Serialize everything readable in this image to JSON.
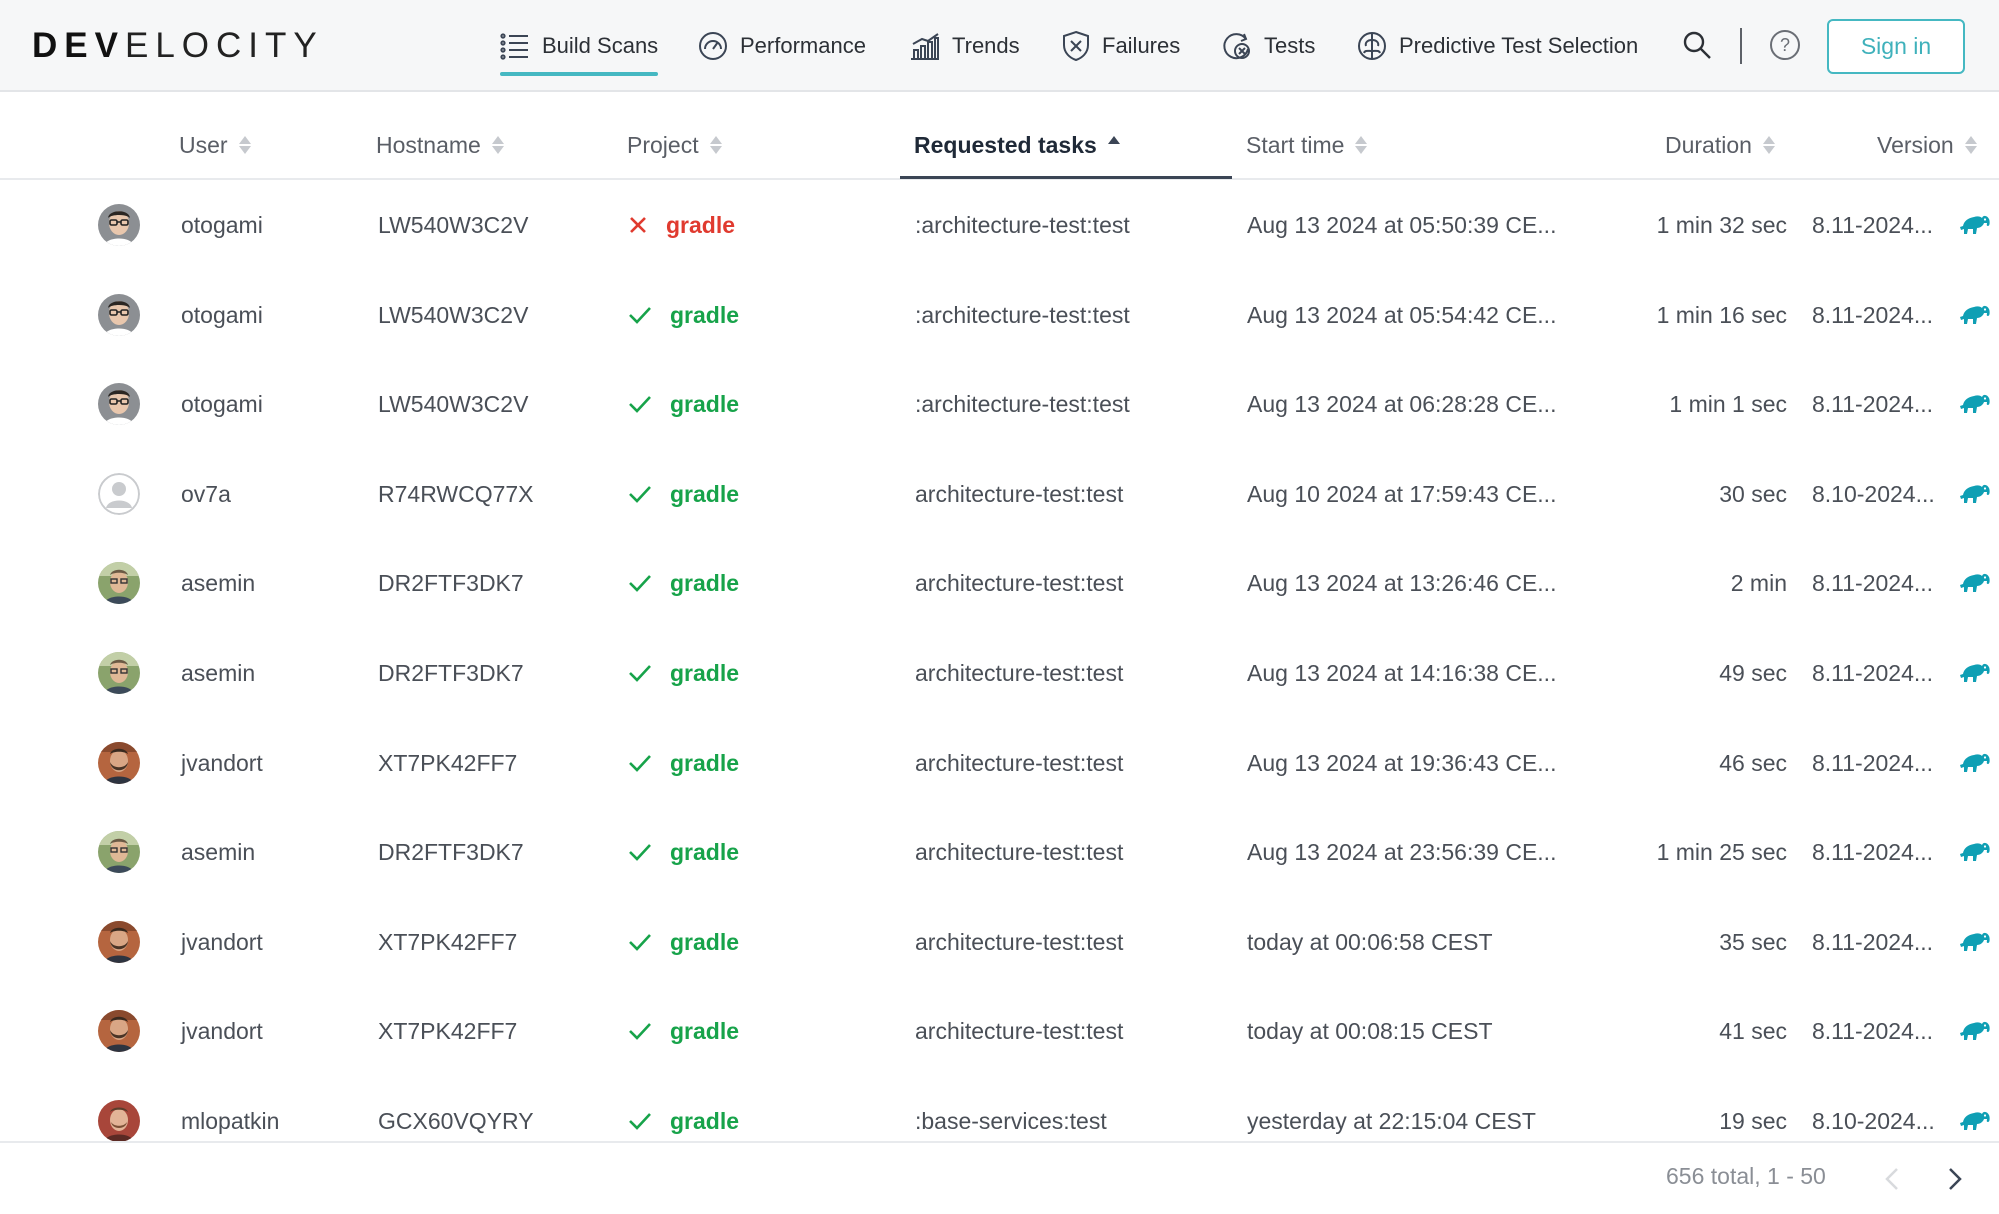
{
  "app": {
    "logo_bold": "DEV",
    "logo_light": "ELOCITY"
  },
  "nav": [
    {
      "label": "Build Scans",
      "icon": "list-icon",
      "active": true
    },
    {
      "label": "Performance",
      "icon": "gauge-icon",
      "active": false
    },
    {
      "label": "Trends",
      "icon": "chart-icon",
      "active": false
    },
    {
      "label": "Failures",
      "icon": "shield-x-icon",
      "active": false
    },
    {
      "label": "Tests",
      "icon": "test-icon",
      "active": false
    },
    {
      "label": "Predictive Test Selection",
      "icon": "brain-icon",
      "active": false
    }
  ],
  "header": {
    "signin_label": "Sign in"
  },
  "table": {
    "columns": [
      {
        "label": "User"
      },
      {
        "label": "Hostname"
      },
      {
        "label": "Project"
      },
      {
        "label": "Requested tasks",
        "active": true,
        "sort": "asc"
      },
      {
        "label": "Start time"
      },
      {
        "label": "Duration"
      },
      {
        "label": "Version"
      }
    ],
    "rows": [
      {
        "user": "otogami",
        "avatar": "glasses",
        "hostname": "LW540W3C2V",
        "status": "failed",
        "project": "gradle",
        "tasks": ":architecture-test:test",
        "start": "Aug 13 2024 at 05:50:39 CE...",
        "duration": "1 min 32 sec",
        "version": "8.11-2024..."
      },
      {
        "user": "otogami",
        "avatar": "glasses",
        "hostname": "LW540W3C2V",
        "status": "success",
        "project": "gradle",
        "tasks": ":architecture-test:test",
        "start": "Aug 13 2024 at 05:54:42 CE...",
        "duration": "1 min 16 sec",
        "version": "8.11-2024..."
      },
      {
        "user": "otogami",
        "avatar": "glasses",
        "hostname": "LW540W3C2V",
        "status": "success",
        "project": "gradle",
        "tasks": ":architecture-test:test",
        "start": "Aug 13 2024 at 06:28:28 CE...",
        "duration": "1 min 1 sec",
        "version": "8.11-2024..."
      },
      {
        "user": "ov7a",
        "avatar": "default",
        "hostname": "R74RWCQ77X",
        "status": "success",
        "project": "gradle",
        "tasks": "architecture-test:test",
        "start": "Aug 10 2024 at 17:59:43 CE...",
        "duration": "30 sec",
        "version": "8.10-2024..."
      },
      {
        "user": "asemin",
        "avatar": "outdoor",
        "hostname": "DR2FTF3DK7",
        "status": "success",
        "project": "gradle",
        "tasks": "architecture-test:test",
        "start": "Aug 13 2024 at 13:26:46 CE...",
        "duration": "2 min",
        "version": "8.11-2024..."
      },
      {
        "user": "asemin",
        "avatar": "outdoor",
        "hostname": "DR2FTF3DK7",
        "status": "success",
        "project": "gradle",
        "tasks": "architecture-test:test",
        "start": "Aug 13 2024 at 14:16:38 CE...",
        "duration": "49 sec",
        "version": "8.11-2024..."
      },
      {
        "user": "jvandort",
        "avatar": "beard",
        "hostname": "XT7PK42FF7",
        "status": "success",
        "project": "gradle",
        "tasks": "architecture-test:test",
        "start": "Aug 13 2024 at 19:36:43 CE...",
        "duration": "46 sec",
        "version": "8.11-2024..."
      },
      {
        "user": "asemin",
        "avatar": "outdoor",
        "hostname": "DR2FTF3DK7",
        "status": "success",
        "project": "gradle",
        "tasks": "architecture-test:test",
        "start": "Aug 13 2024 at 23:56:39 CE...",
        "duration": "1 min 25 sec",
        "version": "8.11-2024..."
      },
      {
        "user": "jvandort",
        "avatar": "beard",
        "hostname": "XT7PK42FF7",
        "status": "success",
        "project": "gradle",
        "tasks": "architecture-test:test",
        "start": "today at 00:06:58 CEST",
        "duration": "35 sec",
        "version": "8.11-2024..."
      },
      {
        "user": "jvandort",
        "avatar": "beard",
        "hostname": "XT7PK42FF7",
        "status": "success",
        "project": "gradle",
        "tasks": "architecture-test:test",
        "start": "today at 00:08:15 CEST",
        "duration": "41 sec",
        "version": "8.11-2024..."
      },
      {
        "user": "mlopatkin",
        "avatar": "red",
        "hostname": "GCX60VQYRY",
        "status": "success",
        "project": "gradle",
        "tasks": ":base-services:test",
        "start": "yesterday at 22:15:04 CEST",
        "duration": "19 sec",
        "version": "8.10-2024..."
      }
    ]
  },
  "footer": {
    "pager_text": "656 total, 1 - 50"
  },
  "colors": {
    "accent": "#45b8c2",
    "success": "#17a34a",
    "failure": "#e03a2f",
    "elephant": "#0f9fb4"
  }
}
